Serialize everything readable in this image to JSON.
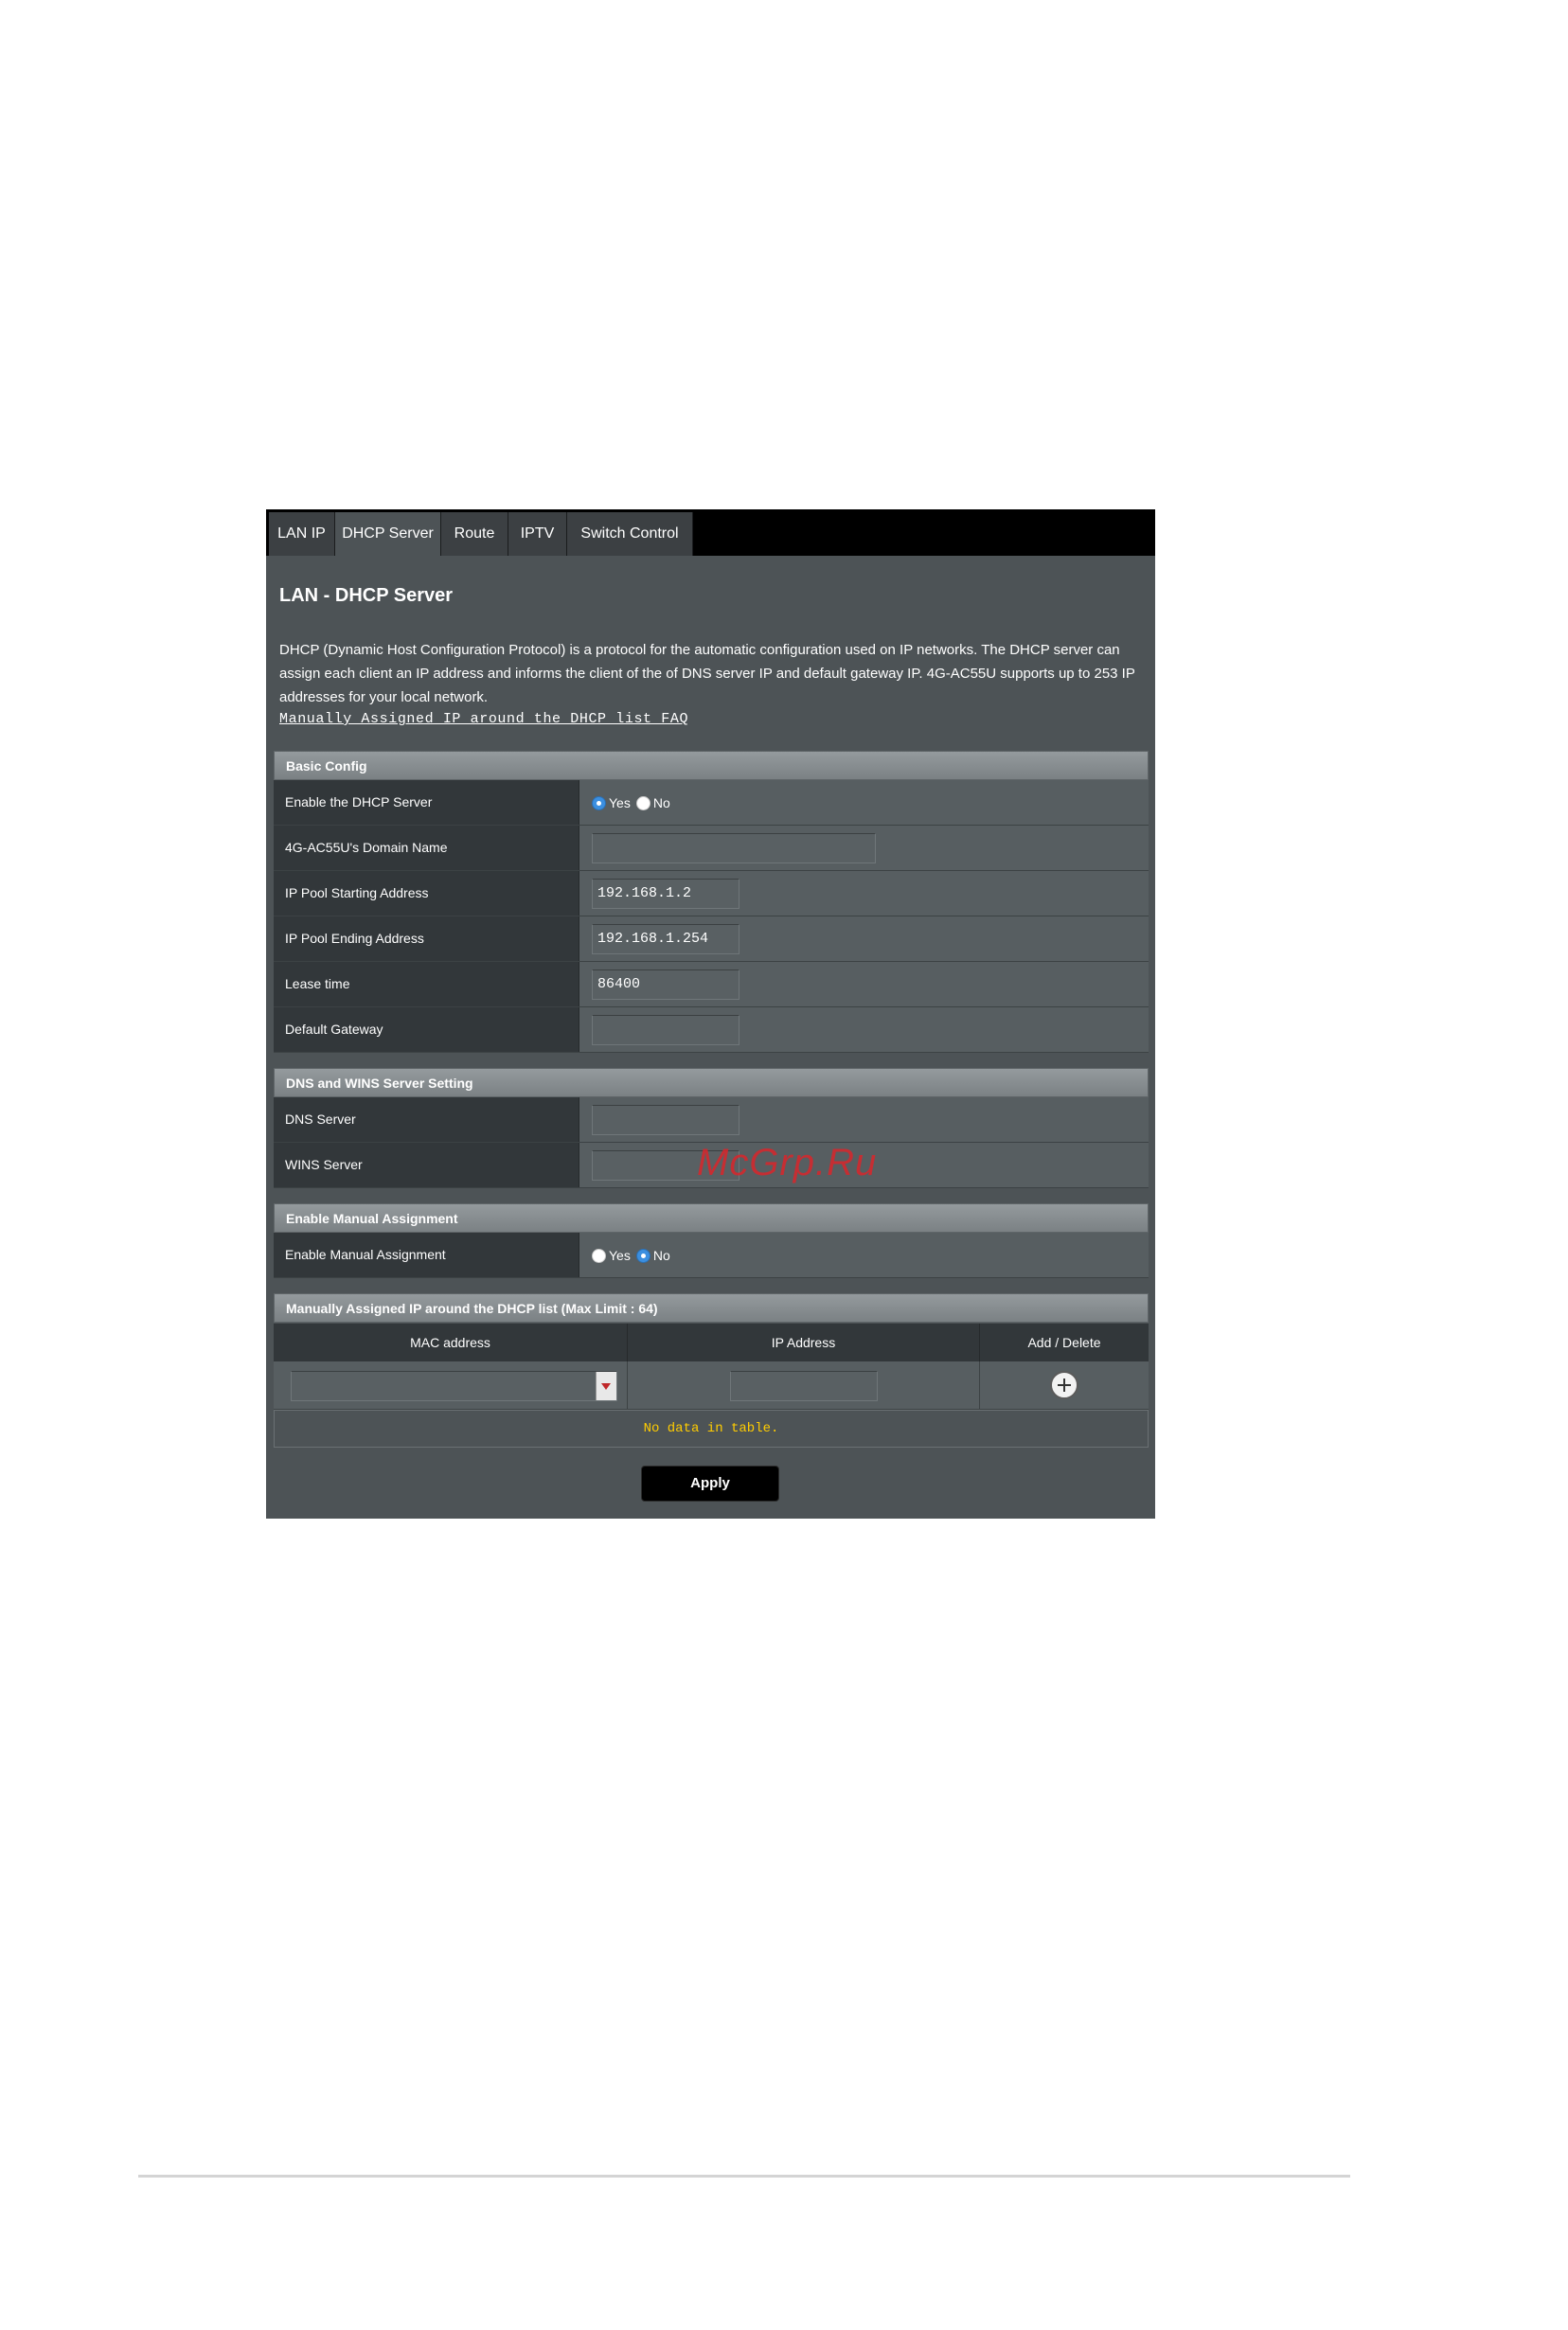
{
  "tabs": [
    {
      "label": "LAN IP"
    },
    {
      "label": "DHCP Server"
    },
    {
      "label": "Route"
    },
    {
      "label": "IPTV"
    },
    {
      "label": "Switch Control"
    }
  ],
  "active_tab": "DHCP Server",
  "page": {
    "title": "LAN - DHCP Server",
    "description": "DHCP (Dynamic Host Configuration Protocol) is a protocol for the automatic configuration used on IP networks. The DHCP server can assign each client an IP address and informs the client of the of DNS server IP and default gateway IP. 4G-AC55U supports up to 253 IP addresses for your local network.",
    "faq_link": "Manually Assigned IP around the DHCP list FAQ"
  },
  "basic_config": {
    "header": "Basic Config",
    "enable_dhcp": {
      "label": "Enable the DHCP Server",
      "yes": "Yes",
      "no": "No",
      "selected": "Yes"
    },
    "domain_name": {
      "label": "4G-AC55U's Domain Name",
      "value": ""
    },
    "pool_start": {
      "label": "IP Pool Starting Address",
      "value": "192.168.1.2"
    },
    "pool_end": {
      "label": "IP Pool Ending Address",
      "value": "192.168.1.254"
    },
    "lease_time": {
      "label": "Lease time",
      "value": "86400"
    },
    "default_gateway": {
      "label": "Default Gateway",
      "value": ""
    }
  },
  "dns_wins": {
    "header": "DNS and WINS Server Setting",
    "dns": {
      "label": "DNS Server",
      "value": ""
    },
    "wins": {
      "label": "WINS Server",
      "value": ""
    }
  },
  "manual_assignment": {
    "header": "Enable Manual Assignment",
    "enable": {
      "label": "Enable Manual Assignment",
      "yes": "Yes",
      "no": "No",
      "selected": "No"
    }
  },
  "manual_list": {
    "header": "Manually Assigned IP around the DHCP list (Max Limit : 64)",
    "columns": [
      "MAC address",
      "IP Address",
      "Add / Delete"
    ],
    "mac_value": "",
    "ip_value": "",
    "empty_text": "No data in table."
  },
  "apply_label": "Apply",
  "watermark": "McGrp.Ru",
  "icons": {
    "add": "plus-circle-icon",
    "dropdown": "chevron-down-icon",
    "radio": "radio-icon"
  }
}
